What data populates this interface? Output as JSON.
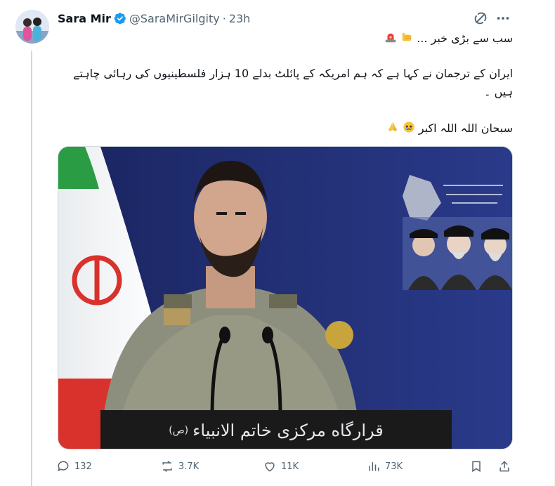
{
  "author": {
    "name": "Sara Mir",
    "handle": "@SaraMirGilgity",
    "separator": "·",
    "time": "23h",
    "avatar_icon": "avatar-two-girls"
  },
  "tweet": {
    "line1": "سب سے بڑی خبر ...",
    "line2": "ایران کے ترجمان نے کہا ہے کہ ہم امریکہ کے پائلٹ بدلے 10 ہزار فلسطینیوں کی رہائی چاہتے",
    "line3": "ہیں ۔",
    "line4": "سبحان اللہ اللہ اکبر",
    "emoji1": "police-light-emoji",
    "emoji2": "fist-emoji",
    "emoji3": "teary-face-emoji",
    "emoji4": "folded-hands-emoji"
  },
  "media": {
    "banner_text": "قرارگاه مرکزی خاتم الانبیاء",
    "banner_suffix": "(ص)"
  },
  "actions": {
    "replies": "132",
    "reposts": "3.7K",
    "likes": "11K",
    "views": "73K"
  },
  "colors": {
    "text": "#0f1419",
    "muted": "#536471",
    "verified": "#1d9bf0",
    "border": "#cfd9de",
    "media_bg": "#1c2a6b"
  }
}
